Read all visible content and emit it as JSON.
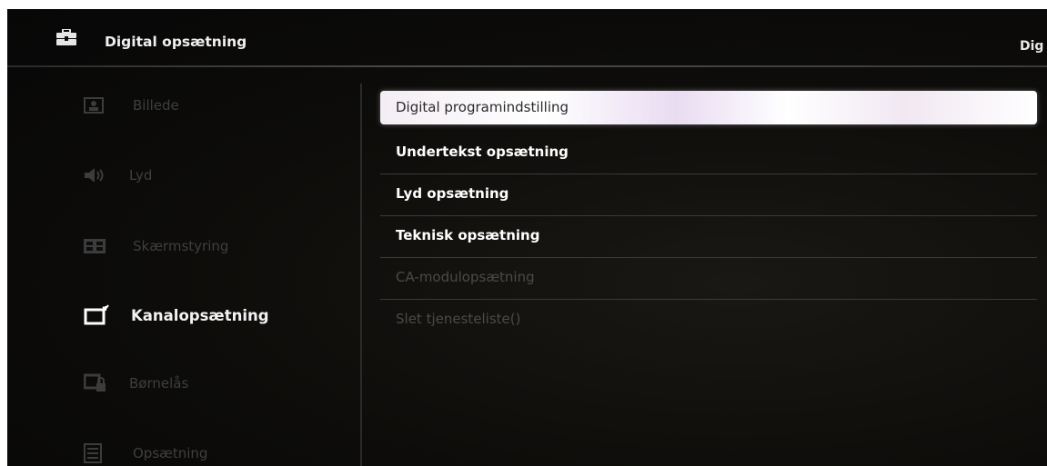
{
  "header": {
    "title": "Digital opsætning",
    "right_text": "Dig",
    "icon": "toolbox-icon"
  },
  "sidebar": {
    "items": [
      {
        "label": "Billede",
        "icon": "picture-icon",
        "active": false
      },
      {
        "label": "Lyd",
        "icon": "speaker-icon",
        "active": false
      },
      {
        "label": "Skærmstyring",
        "icon": "screen-control-icon",
        "active": false
      },
      {
        "label": "Kanalopsætning",
        "icon": "channel-setup-icon",
        "active": true
      },
      {
        "label": "Børnelås",
        "icon": "parental-lock-icon",
        "active": false
      },
      {
        "label": "Opsætning",
        "icon": "setup-icon",
        "active": false
      }
    ]
  },
  "menu": {
    "items": [
      {
        "label": "Digital programindstilling",
        "state": "selected"
      },
      {
        "label": "Undertekst opsætning",
        "state": "enabled"
      },
      {
        "label": "Lyd opsætning",
        "state": "enabled"
      },
      {
        "label": "Teknisk opsætning",
        "state": "enabled"
      },
      {
        "label": "CA-modulopsætning",
        "state": "disabled"
      },
      {
        "label": "Slet tjenesteliste()",
        "state": "disabled"
      }
    ]
  },
  "colors": {
    "background": "#0b0a09",
    "selected_bar": "#f4eef4",
    "active_text": "#ffffff",
    "inactive_text": "#3f3f3f"
  }
}
